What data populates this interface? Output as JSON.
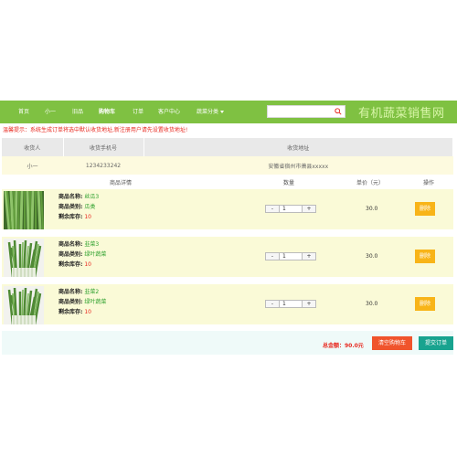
{
  "nav": {
    "items": [
      "首页",
      "小一",
      "旧品",
      "购物车",
      "订单",
      "客户中心",
      "蔬菜分类"
    ],
    "active_index": 3
  },
  "search": {
    "placeholder": "",
    "icon": "search-icon"
  },
  "brand": {
    "title": "有机蔬菜销售网"
  },
  "notice": "温馨提示：系统生成订单将选中默认收货地址,新注册用户请先设置收货地址!",
  "address": {
    "headers": [
      "收货人",
      "收货手机号",
      "收货地址"
    ],
    "row": [
      "小一",
      "1234233242",
      "安徽省宿州市萧县xxxxx"
    ]
  },
  "cart": {
    "headers": {
      "detail": "商品详情",
      "qty": "数量",
      "price": "单价（元）",
      "action": "操作"
    },
    "labels": {
      "name": "商品名称:",
      "category": "商品类别:",
      "stock": "剩余库存:"
    },
    "items": [
      {
        "name": "丝瓜3",
        "category": "瓜类",
        "stock": "10",
        "qty": "1",
        "price": "30.0",
        "delete": "删除"
      },
      {
        "name": "韭菜3",
        "category": "绿叶蔬菜",
        "stock": "10",
        "qty": "1",
        "price": "30.0",
        "delete": "删除"
      },
      {
        "name": "韭菜2",
        "category": "绿叶蔬菜",
        "stock": "10",
        "qty": "1",
        "price": "30.0",
        "delete": "删除"
      }
    ],
    "qty_minus": "-",
    "qty_plus": "+"
  },
  "footer": {
    "total": "总金额：90.0元",
    "clear_button": "清空购物车",
    "submit_button": "提交订单"
  },
  "colors": {
    "nav": "#7fc142",
    "notice": "#e8281f",
    "delete": "#f8b418",
    "clear": "#f0542c",
    "submit": "#18a38f"
  }
}
